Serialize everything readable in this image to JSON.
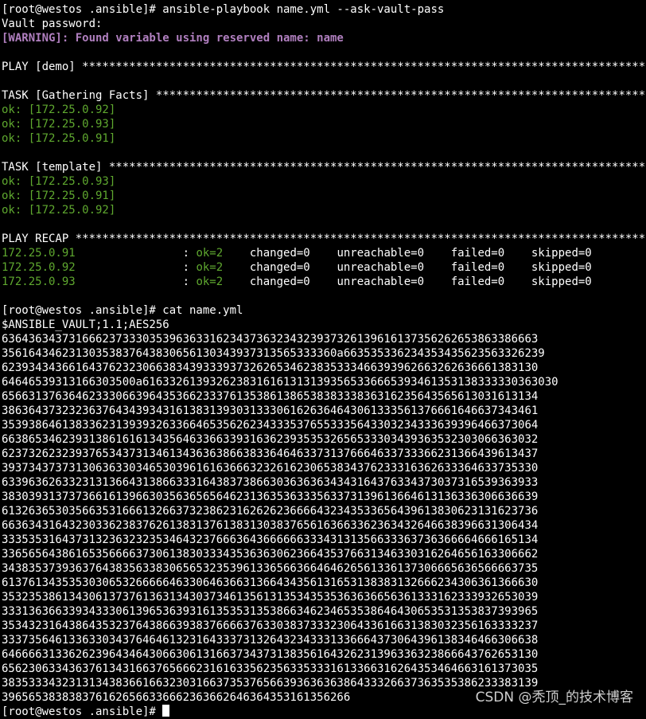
{
  "colors": {
    "background": "#000000",
    "default": "#ffffff",
    "ok": "#5fa82f",
    "warning": "#b07fbf"
  },
  "lines": [
    [
      {
        "t": "[root@westos .ansible]# ansible-playbook name.yml --ask-vault-pass",
        "c": "default"
      }
    ],
    [
      {
        "t": "Vault password:",
        "c": "default"
      }
    ],
    [
      {
        "t": "[WARNING]: Found variable using reserved name: name",
        "c": "warn"
      }
    ],
    [
      {
        "t": "",
        "c": "default"
      }
    ],
    [
      {
        "t": "PLAY [demo] *******************************************************************************************************",
        "c": "default"
      }
    ],
    [
      {
        "t": "",
        "c": "default"
      }
    ],
    [
      {
        "t": "TASK [Gathering Facts] ********************************************************************************************",
        "c": "default"
      }
    ],
    [
      {
        "t": "ok: [172.25.0.92]",
        "c": "ok"
      }
    ],
    [
      {
        "t": "ok: [172.25.0.93]",
        "c": "ok"
      }
    ],
    [
      {
        "t": "ok: [172.25.0.91]",
        "c": "ok"
      }
    ],
    [
      {
        "t": "",
        "c": "default"
      }
    ],
    [
      {
        "t": "TASK [template] ***************************************************************************************************",
        "c": "default"
      }
    ],
    [
      {
        "t": "ok: [172.25.0.93]",
        "c": "ok"
      }
    ],
    [
      {
        "t": "ok: [172.25.0.91]",
        "c": "ok"
      }
    ],
    [
      {
        "t": "ok: [172.25.0.92]",
        "c": "ok"
      }
    ],
    [
      {
        "t": "",
        "c": "default"
      }
    ],
    [
      {
        "t": "PLAY RECAP ********************************************************************************************************",
        "c": "default"
      }
    ],
    [
      {
        "t": "172.25.0.91",
        "c": "ip"
      },
      {
        "t": "                : ",
        "c": "default"
      },
      {
        "t": "ok=2",
        "c": "ok"
      },
      {
        "t": "    changed=0    unreachable=0    failed=0    skipped=0",
        "c": "default"
      }
    ],
    [
      {
        "t": "172.25.0.92",
        "c": "ip"
      },
      {
        "t": "                : ",
        "c": "default"
      },
      {
        "t": "ok=2",
        "c": "ok"
      },
      {
        "t": "    changed=0    unreachable=0    failed=0    skipped=0",
        "c": "default"
      }
    ],
    [
      {
        "t": "172.25.0.93",
        "c": "ip"
      },
      {
        "t": "                : ",
        "c": "default"
      },
      {
        "t": "ok=2",
        "c": "ok"
      },
      {
        "t": "    changed=0    unreachable=0    failed=0    skipped=0",
        "c": "default"
      }
    ],
    [
      {
        "t": "",
        "c": "default"
      }
    ],
    [
      {
        "t": "[root@westos .ansible]# cat name.yml",
        "c": "default"
      }
    ],
    [
      {
        "t": "$ANSIBLE_VAULT;1.1;AES256",
        "c": "default"
      }
    ],
    [
      {
        "t": "63643634373166623733303539636331623437363234323937326139616137356262653863386663",
        "c": "default"
      }
    ],
    [
      {
        "t": "35616434623130353837643830656130343937313565333360a663535336234353435623563326239",
        "c": "default"
      }
    ],
    [
      {
        "t": "62393434366164376232306638343933393732626534623835333466393962663262636661383130",
        "c": "default"
      }
    ],
    [
      {
        "t": "64646539313166303500a61633261393262383161613131393565336665393461353138333330363030",
        "c": "default"
      }
    ],
    [
      {
        "t": "65663137636462333066396435366233376135386138653838333836316235643565613031613134",
        "c": "default"
      }
    ],
    [
      {
        "t": "38636437323236376434393431613831393031333061626364643061333561376661646637343461",
        "c": "default"
      }
    ],
    [
      {
        "t": "35393864613833623139393263366465356262343335376553335643303234333639396466373064",
        "c": "default"
      }
    ],
    [
      {
        "t": "66386534623931386161613435646336633931636239353532656533303439363532303066363032",
        "c": "default"
      }
    ],
    [
      {
        "t": "62373262323937653437313461343636386638336464633731376664633733366231366439613437",
        "c": "default"
      }
    ],
    [
      {
        "t": "39373437373130636330346530396161636663232616230653834376233316362633364633735330",
        "c": "default"
      }
    ],
    [
      {
        "t": "63396362633231313664313866333164383738663036363634343164376334373037316539363933",
        "c": "default"
      }
    ],
    [
      {
        "t": "38303931373736616139663035636565646231363536333563373139613664613136336306636639",
        "c": "default"
      }
    ],
    [
      {
        "t": "61326365303566353166613266373238623162626236666432343533656439613830623131623736",
        "c": "default"
      }
    ],
    [
      {
        "t": "66363431643230336238376261383137613831303837656163663362363432646638396631306434",
        "c": "default"
      }
    ],
    [
      {
        "t": "33353531643731323632323534643237666364366666633343131356633363736366664666165134",
        "c": "default"
      }
    ],
    [
      {
        "t": "33656564386165356666373061383033343536363062366435376631346330316264656163306662",
        "c": "default"
      }
    ],
    [
      {
        "t": "34383537393637643835633830656532353961336566366464626561336137306665636566663735",
        "c": "default"
      }
    ],
    [
      {
        "t": "61376134353530306532666664633064636631366434356131653138383132666234306361366630",
        "c": "default"
      }
    ],
    [
      {
        "t": "35323538613430613737613631343037346135613135343535363636656361333162333932653039",
        "c": "default"
      }
    ],
    [
      {
        "t": "33313636633934333061396536393161353531353866346234653538646430653531353837393965",
        "c": "default"
      }
    ],
    [
      {
        "t": "35343231643864353237643866393837666637633038373332306433616631383032356163333237",
        "c": "default"
      }
    ],
    [
      {
        "t": "33373564613363303437646461323164333731326432343331336664373064396138346466306638",
        "c": "default"
      }
    ],
    [
      {
        "t": "64666631336262396434643066306131663734373138356164326231396336323866643762653130",
        "c": "default"
      }
    ],
    [
      {
        "t": "65623063343637613431663765666231616335623563353331613366316264353464663161373035",
        "c": "default"
      }
    ],
    [
      {
        "t": "38353334323131343836616632303166373537656639363636386433326637363535386233383139",
        "c": "default"
      }
    ],
    [
      {
        "t": "3965653838383761626566336662363662646364353161356266",
        "c": "default"
      }
    ],
    [
      {
        "t": "[root@westos .ansible]# ",
        "c": "default"
      }
    ]
  ],
  "watermark": "CSDN @秃顶_的技术博客"
}
